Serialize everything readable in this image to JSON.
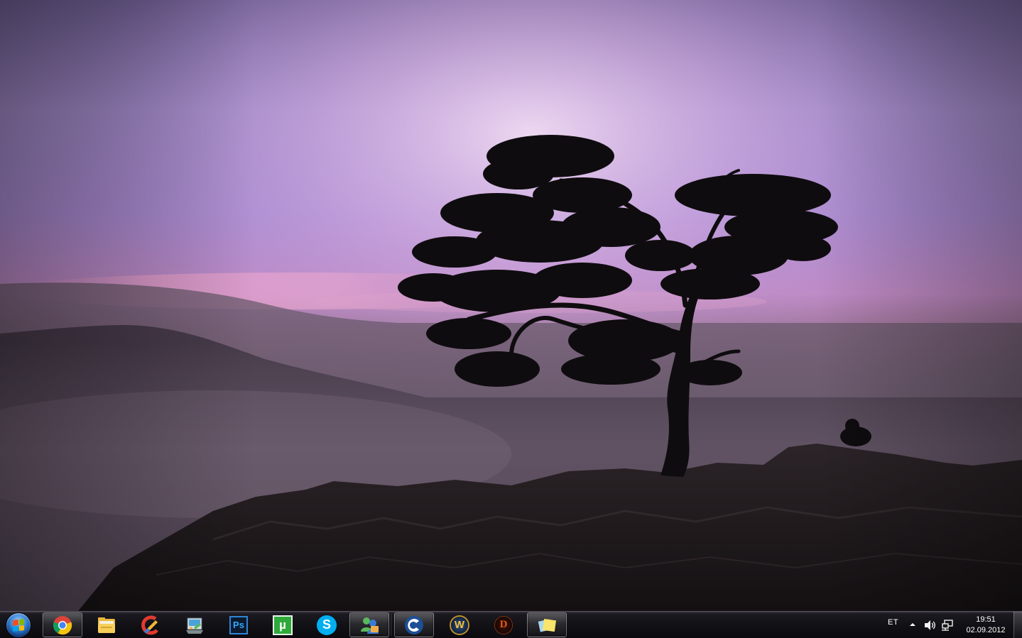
{
  "taskbar": {
    "start_button": {
      "icon": "windows-start-orb"
    },
    "pinned_apps": [
      {
        "name": "Google Chrome",
        "icon": "chrome-icon",
        "active": true
      },
      {
        "name": "Windows Explorer",
        "icon": "folder-icon",
        "active": false
      },
      {
        "name": "CCleaner",
        "icon": "ccleaner-icon",
        "active": false
      },
      {
        "name": "Control Panel",
        "icon": "control-panel-icon",
        "active": false
      },
      {
        "name": "Adobe Photoshop",
        "icon": "photoshop-icon",
        "badge": "Ps",
        "active": false
      },
      {
        "name": "uTorrent",
        "icon": "utorrent-icon",
        "badge": "µ",
        "active": false
      },
      {
        "name": "Skype",
        "icon": "skype-icon",
        "badge": "S",
        "active": false
      },
      {
        "name": "Windows Live Messenger",
        "icon": "messenger-icon",
        "active": true
      },
      {
        "name": "Curse Client",
        "icon": "curse-icon",
        "active": true
      },
      {
        "name": "World of Warcraft",
        "icon": "wow-icon",
        "badge": "W",
        "active": false
      },
      {
        "name": "Diablo III",
        "icon": "diablo-icon",
        "badge": "D",
        "active": false
      },
      {
        "name": "Sticky Notes",
        "icon": "sticky-notes-icon",
        "active": true
      }
    ],
    "tray": {
      "language": "ET",
      "show_hidden_icon": "chevron-up-icon",
      "volume_icon": "speaker-icon",
      "network_icon": "network-icon",
      "time": "19:51",
      "date": "02.09.2012"
    }
  },
  "colors": {
    "sky_top": "#5f4f8a",
    "sky_glow": "#e6c7ec",
    "sky_pink": "#d88ec0",
    "fog": "#5a4d5e",
    "rock": "#1f1a1d",
    "taskbar": "#121116"
  }
}
